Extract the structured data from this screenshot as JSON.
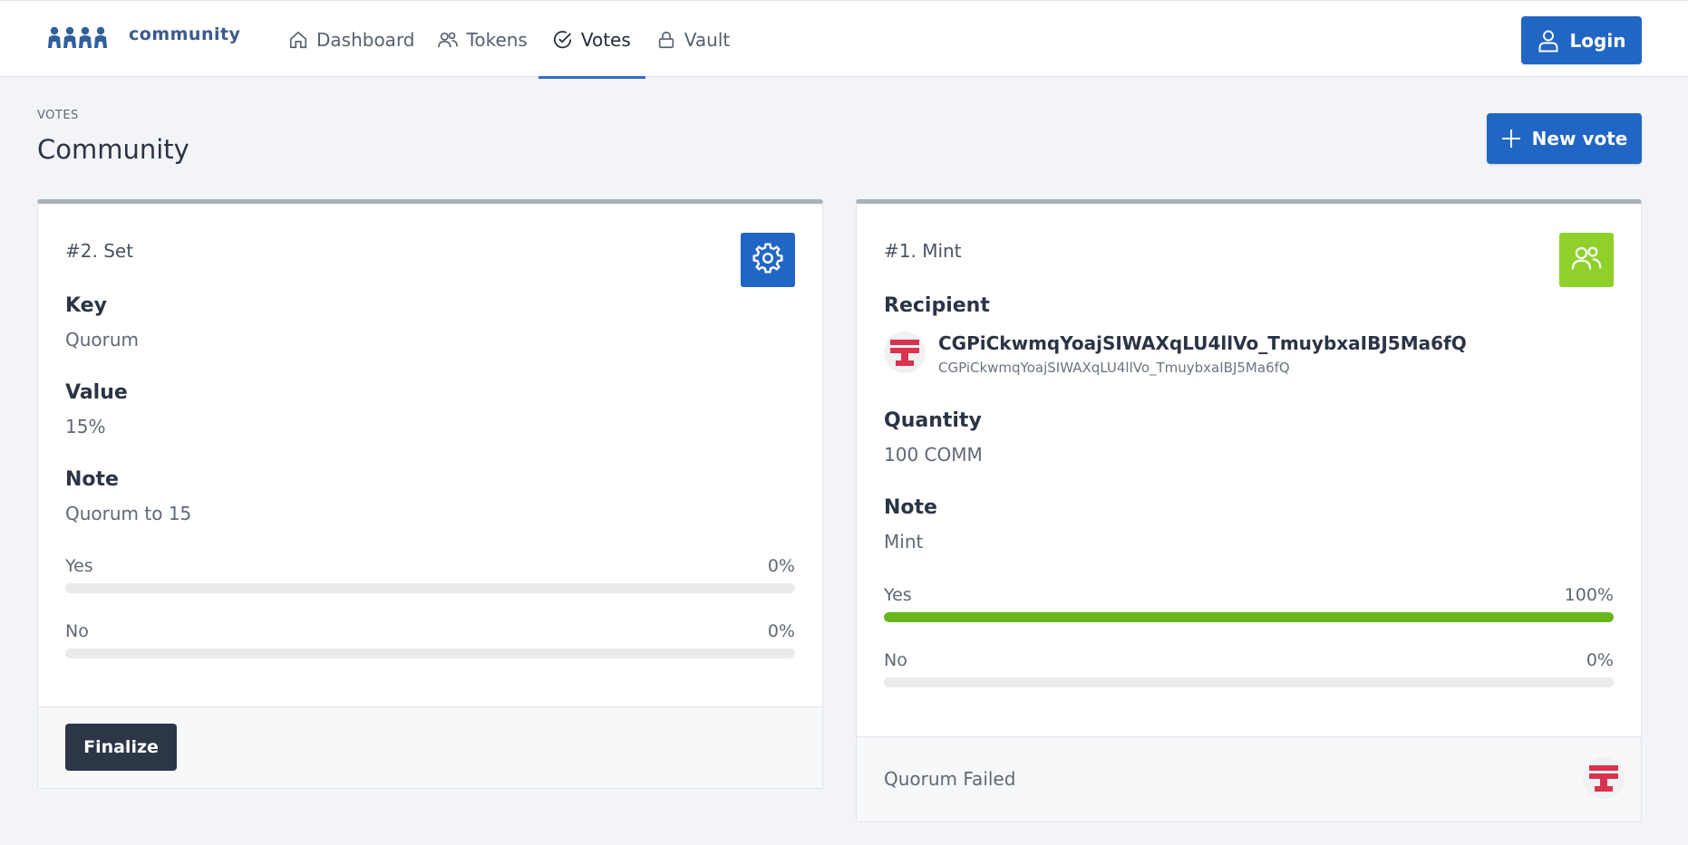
{
  "app": {
    "name": "community"
  },
  "nav": {
    "items": [
      {
        "label": "Dashboard",
        "icon": "home-icon"
      },
      {
        "label": "Tokens",
        "icon": "users-icon"
      },
      {
        "label": "Votes",
        "icon": "check-circle-icon",
        "active": true
      },
      {
        "label": "Vault",
        "icon": "lock-icon"
      }
    ]
  },
  "header": {
    "login_label": "Login"
  },
  "page": {
    "kicker": "VOTES",
    "title": "Community",
    "new_vote_label": "New vote"
  },
  "cards": [
    {
      "heading": "#2. Set",
      "icon": "gear-icon",
      "fields": [
        {
          "label": "Key",
          "value": "Quorum"
        },
        {
          "label": "Value",
          "value": "15%"
        },
        {
          "label": "Note",
          "value": "Quorum to 15"
        }
      ],
      "votes": [
        {
          "label": "Yes",
          "percent": "0%",
          "fraction": 0
        },
        {
          "label": "No",
          "percent": "0%",
          "fraction": 0
        }
      ],
      "footer": {
        "button_label": "Finalize"
      }
    },
    {
      "heading": "#1. Mint",
      "icon": "users-icon",
      "recipient_label": "Recipient",
      "recipient_name": "CGPiCkwmqYoajSIWAXqLU4llVo_TmuybxaIBJ5Ma6fQ",
      "recipient_address": "CGPiCkwmqYoajSIWAXqLU4llVo_TmuybxaIBJ5Ma6fQ",
      "fields": [
        {
          "label": "Quantity",
          "value": "100 COMM"
        },
        {
          "label": "Note",
          "value": "Mint"
        }
      ],
      "votes": [
        {
          "label": "Yes",
          "percent": "100%",
          "fraction": 1
        },
        {
          "label": "No",
          "percent": "0%",
          "fraction": 0
        }
      ],
      "footer": {
        "status": "Quorum Failed"
      }
    }
  ],
  "colors": {
    "primary": "#2166c4",
    "success_bar": "#68b51a",
    "mint_badge": "#8fd12a",
    "dark_button": "#2c3647",
    "avatar_red": "#d9334f"
  }
}
